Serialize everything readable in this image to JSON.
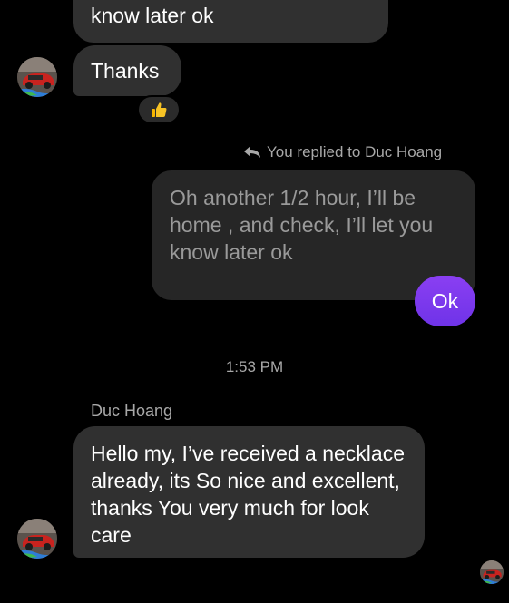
{
  "conversation": {
    "contact_name": "Duc Hoang",
    "messages": {
      "partial_top": {
        "text": "know later ok"
      },
      "thanks": {
        "text": "Thanks",
        "reaction": "thumbs-up"
      },
      "reply_note": {
        "text": "You replied to Duc Hoang"
      },
      "quoted": {
        "text": "Oh another 1/2 hour, I’ll be home , and check, I’ll let you know later ok"
      },
      "my_reply": {
        "text": "Ok"
      },
      "timestamp": {
        "text": "1:53 PM"
      },
      "sender_label": {
        "text": "Duc Hoang"
      },
      "hello": {
        "text": "Hello my, I’ve received a necklace already, its So nice and excellent, thanks You very much for look care"
      }
    }
  },
  "colors": {
    "background": "#000000",
    "incoming_bubble": "#303030",
    "quoted_bubble": "#262626",
    "outgoing_bubble": "#7c3aed",
    "meta_text": "#a8a8a8"
  },
  "icons": {
    "reaction": "thumbs-up-icon",
    "reply": "reply-arrow-icon"
  }
}
